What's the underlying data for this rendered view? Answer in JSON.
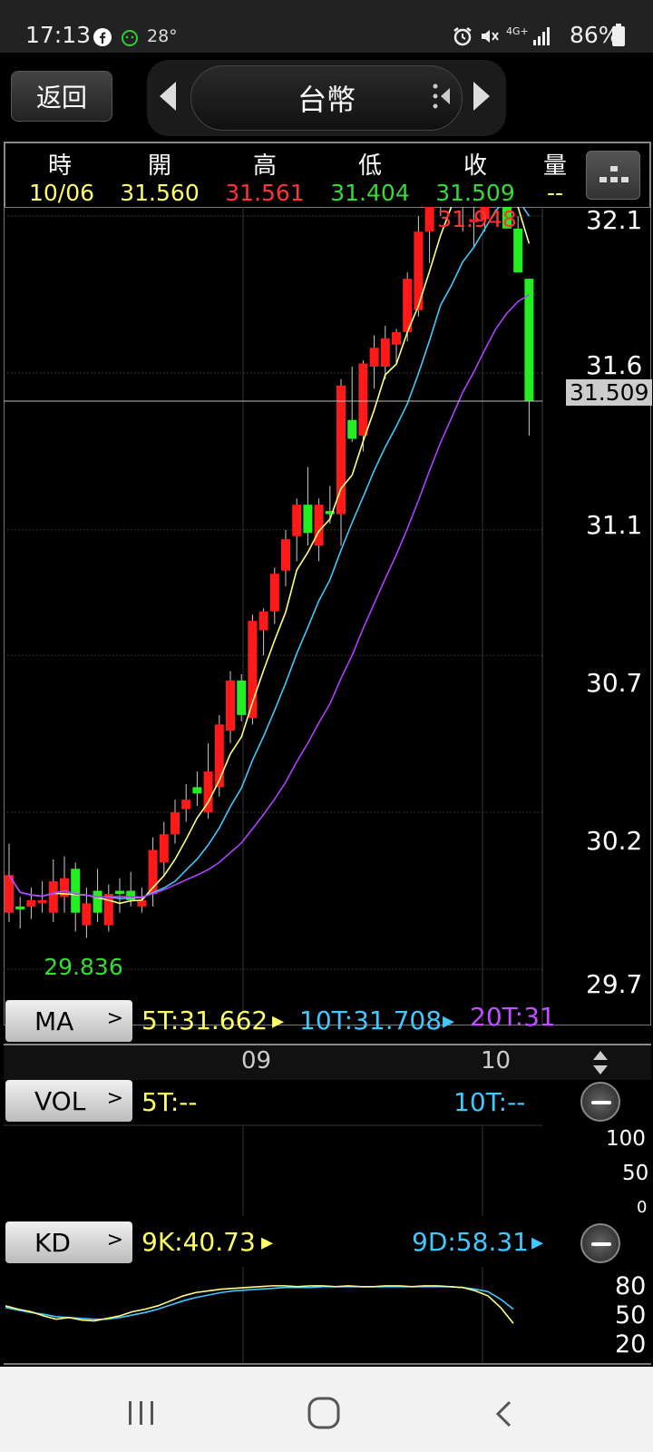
{
  "status_bar": {
    "time": "17:13",
    "temperature": "28°",
    "battery": "86%",
    "network": "4G+"
  },
  "header": {
    "back_label": "返回",
    "title": "台幣"
  },
  "info": {
    "headers": [
      "時",
      "開",
      "高",
      "低",
      "收",
      "量"
    ],
    "values": [
      "10/06",
      "31.560",
      "31.561",
      "31.404",
      "31.509",
      "--"
    ],
    "colors": [
      "#ffff66",
      "#ffff66",
      "#ff3333",
      "#33dd33",
      "#33dd33",
      "#ffff66"
    ]
  },
  "chart": {
    "high_label": "31.948",
    "low_label": "29.836",
    "price_tag": "31.509",
    "y_labels": [
      "32.1",
      "31.6",
      "31.1",
      "30.7",
      "30.2",
      "29.7"
    ],
    "x_labels": [
      "09",
      "10"
    ]
  },
  "ma": {
    "button": "MA",
    "ma5": "5T:31.662",
    "ma10": "10T:31.708",
    "ma20": "20T:31"
  },
  "vol": {
    "button": "VOL",
    "v5": "5T:--",
    "v10": "10T:--",
    "y_labels": [
      "100",
      "50",
      "0"
    ]
  },
  "kd": {
    "button": "KD",
    "k": "9K:40.73",
    "d": "9D:58.31",
    "y_labels": [
      "80",
      "50",
      "20"
    ]
  },
  "colors": {
    "up": "#ff1a1a",
    "down": "#22ee22",
    "ma5": "#ffff80",
    "ma10": "#40c8ff",
    "ma20": "#b040ff"
  },
  "chart_data": {
    "type": "candlestick",
    "ylim": [
      29.7,
      32.1
    ],
    "x_ticks": [
      {
        "label": "09",
        "index": 21
      },
      {
        "label": "10",
        "index": 42
      }
    ],
    "ohlc": [
      [
        29.88,
        30.1,
        29.85,
        30.0
      ],
      [
        29.9,
        29.93,
        29.83,
        29.89
      ],
      [
        29.9,
        29.96,
        29.86,
        29.92
      ],
      [
        29.91,
        29.98,
        29.88,
        29.92
      ],
      [
        29.88,
        30.05,
        29.85,
        29.98
      ],
      [
        29.93,
        30.06,
        29.88,
        29.99
      ],
      [
        30.02,
        30.04,
        29.82,
        29.88
      ],
      [
        29.84,
        29.96,
        29.8,
        29.91
      ],
      [
        29.95,
        30.02,
        29.85,
        29.88
      ],
      [
        29.84,
        29.97,
        29.82,
        29.94
      ],
      [
        29.95,
        29.99,
        29.88,
        29.94
      ],
      [
        29.95,
        30.01,
        29.9,
        29.92
      ],
      [
        29.9,
        29.96,
        29.88,
        29.92
      ],
      [
        29.94,
        30.12,
        29.9,
        30.08
      ],
      [
        30.04,
        30.17,
        30.0,
        30.13
      ],
      [
        30.13,
        30.24,
        30.1,
        30.2
      ],
      [
        30.21,
        30.29,
        30.17,
        30.24
      ],
      [
        30.28,
        30.33,
        30.22,
        30.26
      ],
      [
        30.2,
        30.42,
        30.18,
        30.33
      ],
      [
        30.28,
        30.51,
        30.25,
        30.48
      ],
      [
        30.46,
        30.65,
        30.42,
        30.62
      ],
      [
        30.62,
        30.64,
        30.49,
        30.51
      ],
      [
        30.5,
        30.83,
        30.48,
        30.81
      ],
      [
        30.78,
        30.85,
        30.7,
        30.84
      ],
      [
        30.84,
        30.98,
        30.8,
        30.96
      ],
      [
        30.97,
        31.1,
        30.92,
        31.07
      ],
      [
        31.08,
        31.2,
        31.0,
        31.18
      ],
      [
        31.18,
        31.3,
        31.05,
        31.09
      ],
      [
        31.05,
        31.2,
        31.0,
        31.18
      ],
      [
        31.16,
        31.24,
        31.12,
        31.15
      ],
      [
        31.15,
        31.58,
        31.05,
        31.56
      ],
      [
        31.45,
        31.62,
        31.38,
        31.39
      ],
      [
        31.4,
        31.64,
        31.35,
        31.63
      ],
      [
        31.62,
        31.72,
        31.55,
        31.68
      ],
      [
        31.62,
        31.75,
        31.58,
        31.71
      ],
      [
        31.69,
        31.74,
        31.63,
        31.73
      ],
      [
        31.73,
        31.92,
        31.7,
        31.9
      ],
      [
        31.8,
        32.1,
        31.78,
        32.05
      ],
      [
        32.05,
        32.22,
        31.95,
        32.23
      ],
      [
        32.3,
        32.37,
        32.1,
        32.28
      ],
      [
        32.28,
        32.34,
        32.18,
        32.2
      ],
      [
        32.2,
        32.4,
        32.05,
        32.13
      ],
      [
        32.08,
        32.29,
        32.0,
        32.09
      ],
      [
        32.09,
        32.31,
        32.05,
        32.27
      ],
      [
        32.3,
        32.38,
        32.18,
        32.3
      ],
      [
        32.27,
        32.35,
        32.2,
        32.06
      ],
      [
        32.06,
        32.1,
        31.95,
        31.92
      ],
      [
        31.9,
        31.6,
        31.4,
        31.51
      ]
    ],
    "k_values": [
      62,
      58,
      55,
      50,
      46,
      48,
      45,
      44,
      47,
      50,
      55,
      58,
      62,
      68,
      74,
      78,
      80,
      82,
      83,
      84,
      85,
      86,
      86,
      85,
      86,
      86,
      85,
      86,
      85,
      85,
      86,
      86,
      85,
      86,
      86,
      85,
      84,
      80,
      74,
      60,
      41
    ],
    "d_values": [
      60,
      57,
      54,
      52,
      49,
      48,
      47,
      46,
      46,
      48,
      51,
      54,
      58,
      63,
      68,
      72,
      75,
      78,
      80,
      81,
      82,
      83,
      84,
      84,
      84,
      85,
      85,
      85,
      85,
      85,
      85,
      85,
      85,
      85,
      85,
      85,
      84,
      82,
      79,
      70,
      58
    ]
  }
}
